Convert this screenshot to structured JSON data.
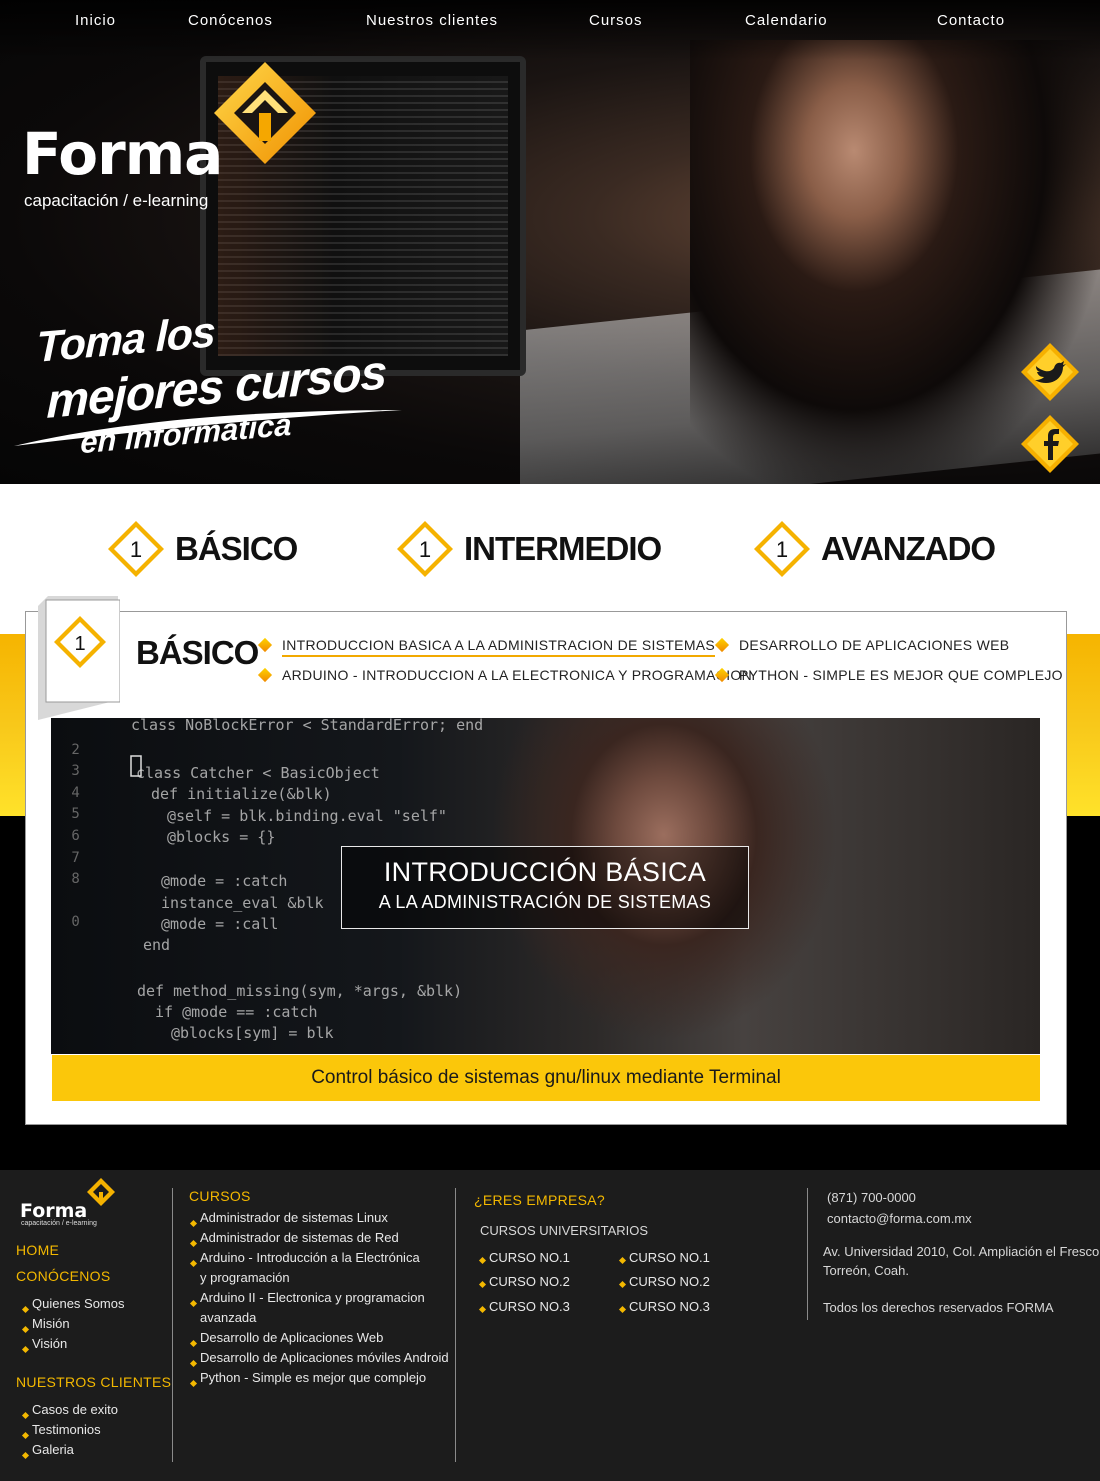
{
  "nav": {
    "items": [
      "Inicio",
      "Conócenos",
      "Nuestros clientes",
      "Cursos",
      "Calendario",
      "Contacto"
    ]
  },
  "brand": {
    "name": "Forma",
    "tagline": "capacitación / e-learning"
  },
  "hero": {
    "slogan_line1": "Toma los",
    "slogan_line2": "mejores cursos",
    "slogan_line3": "en informática"
  },
  "social": [
    "twitter-icon",
    "facebook-icon"
  ],
  "levels": [
    {
      "number": "1",
      "label": "BÁSICO"
    },
    {
      "number": "1",
      "label": "INTERMEDIO"
    },
    {
      "number": "1",
      "label": "AVANZADO"
    }
  ],
  "panel": {
    "number": "1",
    "title": "BÁSICO",
    "courses": [
      {
        "label": "INTRODUCCION BASICA A LA ADMINISTRACION DE SISTEMAS",
        "active": true
      },
      {
        "label": "ARDUINO - INTRODUCCION A LA ELECTRONICA Y PROGRAMACION",
        "active": false
      },
      {
        "label": "DESARROLLO DE APLICACIONES WEB",
        "active": false
      },
      {
        "label": "PYTHON - SIMPLE ES MEJOR QUE COMPLEJO",
        "active": false
      }
    ],
    "feature_title": "INTRODUCCIÓN BÁSICA",
    "feature_subtitle": "A LA ADMINISTRACIÓN DE SISTEMAS",
    "caption": "Control básico de sistemas gnu/linux mediante Terminal"
  },
  "footer": {
    "brand": "Forma",
    "brand_sub": "capacitación / e-learning",
    "home": "HOME",
    "conocenos": "CONÓCENOS",
    "conocenos_items": [
      "Quienes Somos",
      "Misión",
      "Visión"
    ],
    "clientes": "NUESTROS CLIENTES",
    "clientes_items": [
      "Casos de exito",
      "Testimonios",
      "Galeria"
    ],
    "cursos_head": "CURSOS",
    "cursos_items": [
      "Administrador de sistemas Linux",
      "Administrador de sistemas de Red",
      "Arduino - Introducción a la Electrónica",
      "y programación",
      "Arduino II - Electronica y programacion",
      "avanzada",
      "Desarrollo de Aplicaciones Web",
      "Desarrollo de Aplicaciones móviles Android",
      "Python - Simple es mejor que complejo"
    ],
    "empresa_head": "¿ERES EMPRESA?",
    "universitarios": "CURSOS UNIVERSITARIOS",
    "curso_col1": [
      "CURSO NO.1",
      "CURSO NO.2",
      "CURSO NO.3"
    ],
    "curso_col2": [
      "CURSO NO.1",
      "CURSO NO.2",
      "CURSO NO.3"
    ],
    "phone": "(871) 700-0000",
    "email": "contacto@forma.com.mx",
    "address1": "Av. Universidad 2010, Col. Ampliación el Fresco",
    "address2": "Torreón, Coah.",
    "rights": "Todos los derechos reservados FORMA"
  }
}
